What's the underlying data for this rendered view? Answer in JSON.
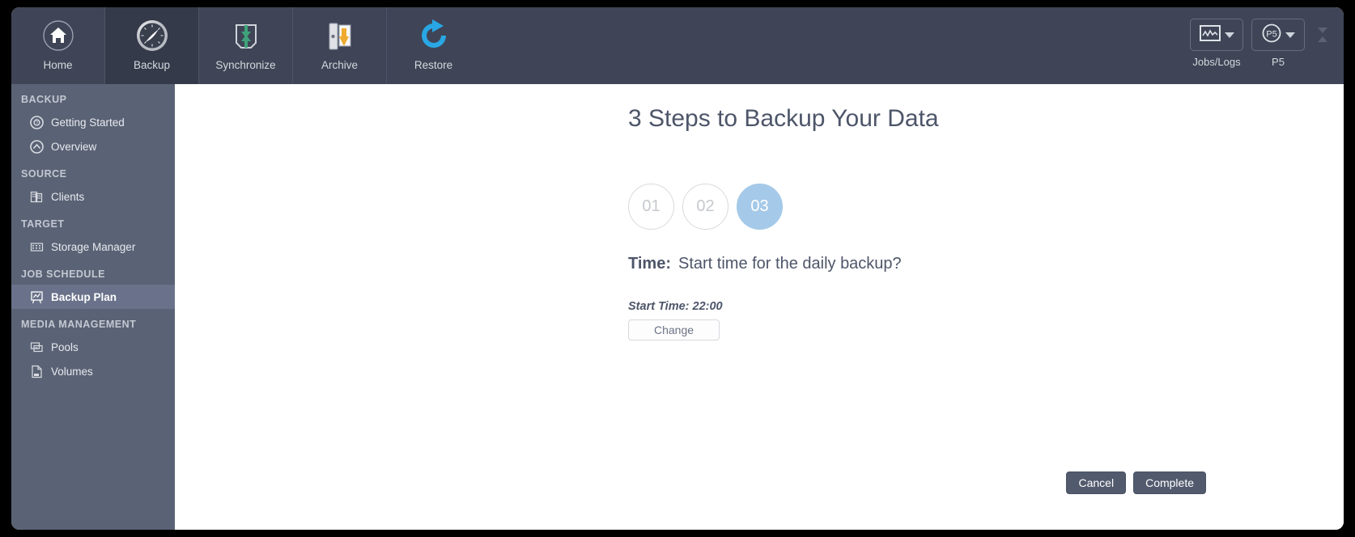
{
  "toolbar": {
    "tabs": [
      {
        "label": "Home",
        "icon": "home-icon",
        "active": false
      },
      {
        "label": "Backup",
        "icon": "compass-icon",
        "active": true
      },
      {
        "label": "Synchronize",
        "icon": "synchronize-icon",
        "active": false
      },
      {
        "label": "Archive",
        "icon": "archive-icon",
        "active": false
      },
      {
        "label": "Restore",
        "icon": "restore-icon",
        "active": false
      }
    ],
    "right": [
      {
        "label": "Jobs/Logs",
        "icon": "chart-window-icon"
      },
      {
        "label": "P5",
        "icon": "p5-logo-icon"
      }
    ]
  },
  "sidebar": {
    "groups": [
      {
        "title": "BACKUP",
        "items": [
          {
            "label": "Getting Started",
            "icon": "lifering-icon",
            "active": false
          },
          {
            "label": "Overview",
            "icon": "overview-icon",
            "active": false
          }
        ]
      },
      {
        "title": "SOURCE",
        "items": [
          {
            "label": "Clients",
            "icon": "clients-icon",
            "active": false
          }
        ]
      },
      {
        "title": "TARGET",
        "items": [
          {
            "label": "Storage Manager",
            "icon": "storage-manager-icon",
            "active": false
          }
        ]
      },
      {
        "title": "JOB SCHEDULE",
        "items": [
          {
            "label": "Backup Plan",
            "icon": "backup-plan-icon",
            "active": true
          }
        ]
      },
      {
        "title": "MEDIA MANAGEMENT",
        "items": [
          {
            "label": "Pools",
            "icon": "pools-icon",
            "active": false
          },
          {
            "label": "Volumes",
            "icon": "volumes-icon",
            "active": false
          }
        ]
      }
    ]
  },
  "main": {
    "title": "3 Steps to Backup Your Data",
    "steps": [
      {
        "number": "01",
        "state": "idle"
      },
      {
        "number": "02",
        "state": "idle"
      },
      {
        "number": "03",
        "state": "current"
      }
    ],
    "question_label": "Time:",
    "question_text": "Start time for the daily backup?",
    "value_text": "Start Time: 22:00",
    "change_label": "Change",
    "cancel_label": "Cancel",
    "complete_label": "Complete"
  },
  "colors": {
    "toolbar_bg": "#3f4556",
    "toolbar_active": "#343a49",
    "sidebar_bg": "#5a6375",
    "sidebar_active": "#69728a",
    "accent_step": "#a5c9e8",
    "button_dark": "#525a6d",
    "text_slate": "#4d5569"
  }
}
